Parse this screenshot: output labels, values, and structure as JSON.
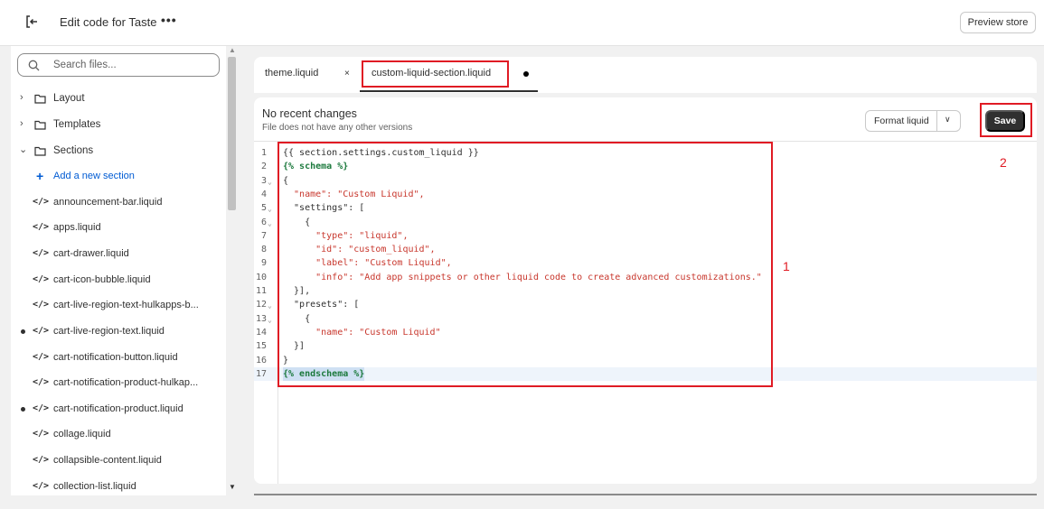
{
  "header": {
    "title": "Edit code for Taste",
    "more": "•••",
    "preview_label": "Preview store"
  },
  "sidebar": {
    "search_placeholder": "Search files...",
    "folders": [
      {
        "label": "Layout",
        "expanded": false
      },
      {
        "label": "Templates",
        "expanded": false
      },
      {
        "label": "Sections",
        "expanded": true
      }
    ],
    "add_section": "Add a new section",
    "files": [
      {
        "name": "announcement-bar.liquid",
        "modified": false
      },
      {
        "name": "apps.liquid",
        "modified": false
      },
      {
        "name": "cart-drawer.liquid",
        "modified": false
      },
      {
        "name": "cart-icon-bubble.liquid",
        "modified": false
      },
      {
        "name": "cart-live-region-text-hulkapps-b...",
        "modified": false
      },
      {
        "name": "cart-live-region-text.liquid",
        "modified": true
      },
      {
        "name": "cart-notification-button.liquid",
        "modified": false
      },
      {
        "name": "cart-notification-product-hulkap...",
        "modified": false
      },
      {
        "name": "cart-notification-product.liquid",
        "modified": true
      },
      {
        "name": "collage.liquid",
        "modified": false
      },
      {
        "name": "collapsible-content.liquid",
        "modified": false
      },
      {
        "name": "collection-list.liquid",
        "modified": false
      }
    ]
  },
  "tabs": [
    {
      "label": "theme.liquid",
      "close": "×"
    },
    {
      "label": "custom-liquid-section.liquid",
      "unsaved": true
    }
  ],
  "editor": {
    "header_title": "No recent changes",
    "header_subtitle": "File does not have any other versions",
    "format_label": "Format liquid",
    "save_label": "Save",
    "lines": [
      "{{ section.settings.custom_liquid }}",
      "{% schema %}",
      "{",
      "  \"name\": \"Custom Liquid\",",
      "  \"settings\": [",
      "    {",
      "      \"type\": \"liquid\",",
      "      \"id\": \"custom_liquid\",",
      "      \"label\": \"Custom Liquid\",",
      "      \"info\": \"Add app snippets or other liquid code to create advanced customizations.\"",
      "  }],",
      "  \"presets\": [",
      "    {",
      "      \"name\": \"Custom Liquid\"",
      "  }]",
      "}",
      "{% endschema %}"
    ]
  },
  "annotations": [
    "1",
    "2"
  ],
  "colors": {
    "highlight": "#e01b24",
    "save_bg": "#303030",
    "link": "#005bd3",
    "keyword": "#1d7a3e",
    "string": "#c8372d"
  }
}
